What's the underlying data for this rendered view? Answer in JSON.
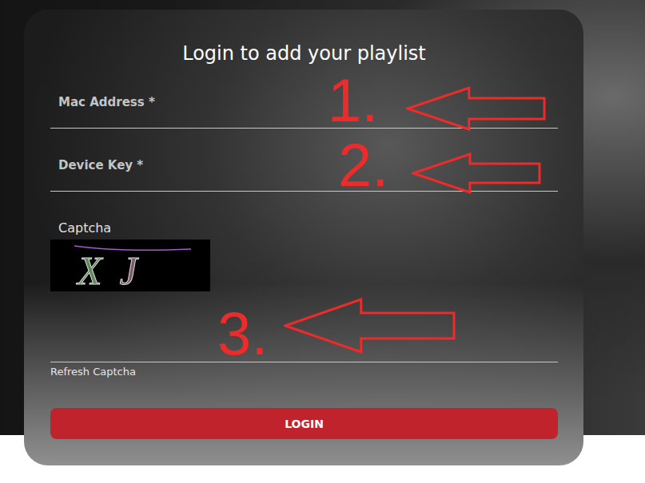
{
  "card": {
    "title": "Login to add your playlist"
  },
  "fields": [
    {
      "label": "Mac Address *",
      "annotation": "1."
    },
    {
      "label": "Device Key *",
      "annotation": "2."
    }
  ],
  "captcha": {
    "label": "Captcha",
    "code": [
      {
        "char": "X",
        "color": "#5d8a57"
      },
      {
        "char": "J",
        "color": "#7d5868"
      }
    ],
    "annotation": "3.",
    "refresh": "Refresh Captcha"
  },
  "buttons": [
    "LOGIN"
  ]
}
